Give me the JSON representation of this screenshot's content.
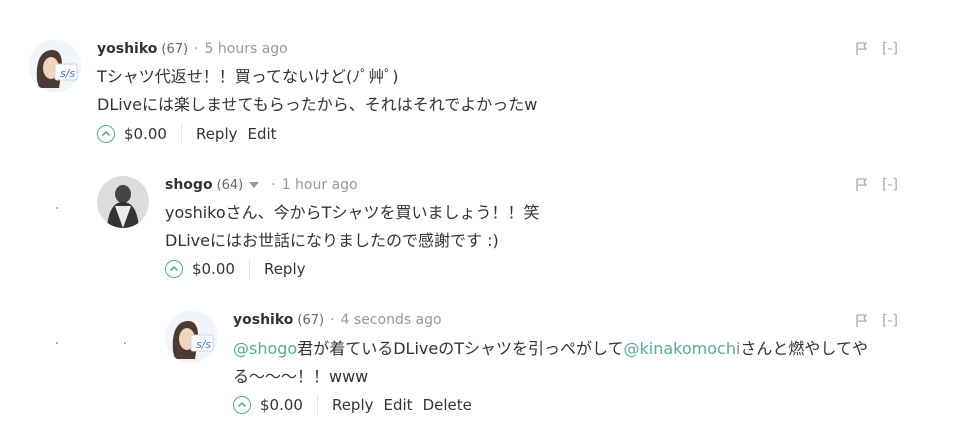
{
  "comments": [
    {
      "author": "yoshiko",
      "reputation": "(67)",
      "separator": "·",
      "time": "5 hours ago",
      "lines": [
        "Tシャツ代返せ！！買ってないけど(ﾉﾟ艸ﾟ)",
        "DLiveには楽しませてもらったから、それはそれでよかったw"
      ],
      "payout": "$0.00",
      "actions": [
        "Reply",
        "Edit"
      ],
      "collapse": "[-]"
    },
    {
      "author": "shogo",
      "reputation": "(64)",
      "separator": "·",
      "time": "1 hour ago",
      "lines": [
        "yoshikoさん、今からTシャツを買いましょう！！笑",
        "DLiveにはお世話になりましたので感謝です :)"
      ],
      "payout": "$0.00",
      "actions": [
        "Reply"
      ],
      "collapse": "[-]"
    },
    {
      "author": "yoshiko",
      "reputation": "(67)",
      "separator": "·",
      "time": "4 seconds ago",
      "body_parts": {
        "mention1": "@shogo",
        "text1": "君が着ているDLiveのTシャツを引っぺがして",
        "mention2": "@kinakomochi",
        "text2": "さんと燃やしてや",
        "line2": "る〜〜〜！！www"
      },
      "payout": "$0.00",
      "actions": [
        "Reply",
        "Edit",
        "Delete"
      ],
      "collapse": "[-]"
    }
  ],
  "colors": {
    "accent": "#52b28f",
    "mention": "#5aab96",
    "muted": "#999999"
  },
  "icons": [
    "upvote-chevron-icon",
    "flag-icon",
    "dropdown-caret-icon"
  ]
}
